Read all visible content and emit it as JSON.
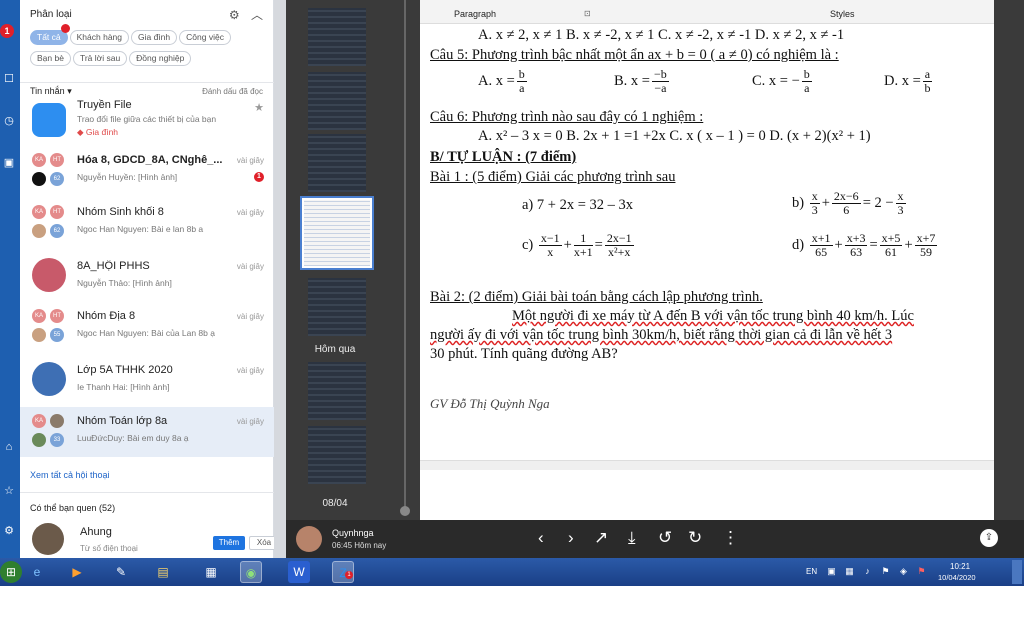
{
  "sidebar": {
    "badge": "1"
  },
  "chat": {
    "category_label": "Phân loại",
    "filters": [
      "Tất cả",
      "Khách hàng",
      "Gia đình",
      "Công việc",
      "Bạn bè",
      "Trả lời sau",
      "Đồng nghiệp"
    ],
    "messages_label": "Tin nhắn ▾",
    "mark_read": "Đánh dấu đã đọc",
    "conversations": [
      {
        "name": "Truyền File",
        "preview": "Trao đổi file giữa các thiết bị của bạn",
        "tag": "Gia đình",
        "time": ""
      },
      {
        "name": "Hóa 8, GDCD_8A, CNghê_...",
        "preview": "Nguyễn Huyền: [Hình ảnh]",
        "time": "vài giây",
        "unread": "1",
        "count": "62"
      },
      {
        "name": "Nhóm Sinh khối 8",
        "preview": "Ngoc Han Nguyen: Bài e lan 8b a",
        "time": "vài giây",
        "count": "62"
      },
      {
        "name": "8A_HỘI PHHS",
        "preview": "Nguyễn Thảo: [Hình ảnh]",
        "time": "vài giây"
      },
      {
        "name": "Nhóm Địa 8",
        "preview": "Ngoc Han Nguyen: Bài của Lan 8b ạ",
        "time": "vài giây",
        "count": "55"
      },
      {
        "name": "Lớp 5A THHK 2020",
        "preview": "Ie Thanh Hai: [Hình ảnh]",
        "time": "vài giây"
      },
      {
        "name": "Nhóm Toán lớp 8a",
        "preview": "LuuĐứcDuy: Bài em duy 8a ạ",
        "time": "vài giây",
        "count": "33"
      }
    ],
    "see_all": "Xem tất cả hội thoại",
    "maybe_know": "Có thể bạn quen (52)",
    "suggest": {
      "name": "Ahung",
      "sub": "Từ số điện thoại",
      "add": "Thêm",
      "remove": "Xóa"
    }
  },
  "viewer": {
    "date_yesterday": "Hôm qua",
    "date_0804": "08/04",
    "sender": "Quynhnga",
    "sent_time": "06:45 Hôm nay",
    "ribbon_paragraph": "Paragraph",
    "ribbon_styles": "Styles",
    "doc": {
      "q4_opts": "A. x ≠ 2, x ≠ 1      B. x ≠ -2, x ≠ 1      C. x ≠ -2, x ≠ -1      D. x ≠ 2, x ≠ -1",
      "q5": "Câu 5: Phương trình bậc nhất một ẩn ax + b = 0 ( a ≠ 0) có nghiệm là :",
      "q5_a": "A. x =",
      "q5_b": "B. x =",
      "q5_c": "C. x = −",
      "q5_d": "D. x =",
      "q6": "Câu 6: Phương trình nào sau đây có 1 nghiệm :",
      "q6_opts": "A. x² – 3 x = 0   B.  2x + 1  =1 +2x   C. x ( x – 1 ) = 0    D. (x + 2)(x² + 1)",
      "section": "B/ TỰ LUẬN : (7 điểm)",
      "bai1": "Bài 1 : (5 điểm) Giải các phương trình sau",
      "b1a": "a) 7 + 2x = 32 – 3x",
      "b1b": "b)",
      "b1c": "c)",
      "b1d": "d)",
      "bai2": "Bài 2: (2 điểm)  Giải bài toán bằng cách lập phương trình.",
      "bai2_l1": "Một người đi xe máy từ A đến B với vận tốc trung bình 40 km/h. Lúc",
      "bai2_l2": "người ấy đi với vận tốc  trung bình 30km/h, biết rằng thời gian cả  đi lẫn về hết 3",
      "bai2_l3": "30 phút. Tính quãng đường AB?",
      "author": "GV Đỗ Thị Quỳnh Nga"
    }
  },
  "taskbar": {
    "lang": "EN",
    "time": "10:21",
    "date": "10/04/2020",
    "zalo_badge": "1"
  }
}
